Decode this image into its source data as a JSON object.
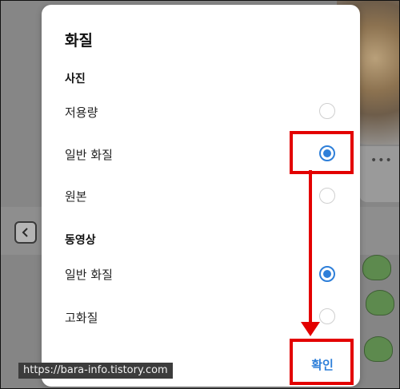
{
  "dialog": {
    "title": "화질",
    "photo_section": {
      "heading": "사진",
      "options": [
        {
          "label": "저용량",
          "selected": false
        },
        {
          "label": "일반 화질",
          "selected": true
        },
        {
          "label": "원본",
          "selected": false
        }
      ]
    },
    "video_section": {
      "heading": "동영상",
      "options": [
        {
          "label": "일반 화질",
          "selected": true
        },
        {
          "label": "고화질",
          "selected": false
        }
      ]
    },
    "confirm_label": "확인"
  },
  "background": {
    "more_icon": "more-dots-icon",
    "back_icon": "chevron-left-icon"
  },
  "watermark": "https://bara-info.tistory.com",
  "colors": {
    "accent": "#2e7fd9",
    "annotation": "#e30000"
  }
}
